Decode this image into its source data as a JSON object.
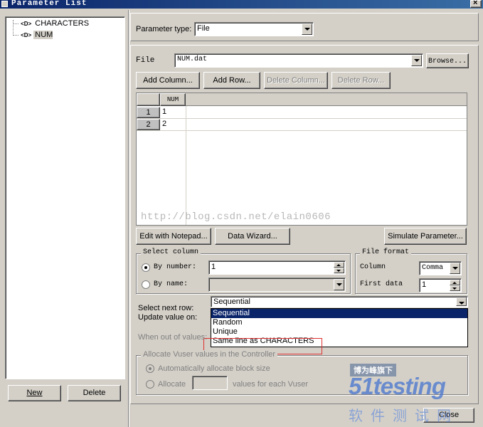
{
  "window": {
    "title": "Parameter List"
  },
  "tree": {
    "items": [
      {
        "tag": "<D>",
        "label": "CHARACTERS"
      },
      {
        "tag": "<D>",
        "label": "NUM"
      }
    ]
  },
  "bottom_buttons": {
    "new": "New",
    "delete": "Delete",
    "close": "Close"
  },
  "param_type": {
    "label": "Parameter type:",
    "value": "File"
  },
  "file": {
    "label": "File",
    "value": "NUM.dat",
    "browse": "Browse..."
  },
  "grid_buttons": {
    "add_column": "Add Column...",
    "add_row": "Add Row...",
    "delete_column": "Delete Column...",
    "delete_row": "Delete Row..."
  },
  "grid": {
    "header": "NUM",
    "rows": [
      {
        "num": "1",
        "value": "1"
      },
      {
        "num": "2",
        "value": "2"
      }
    ]
  },
  "watermark_text": "http://blog.csdn.net/elain0606",
  "tool_buttons": {
    "edit_notepad": "Edit with Notepad...",
    "data_wizard": "Data Wizard...",
    "simulate": "Simulate Parameter..."
  },
  "select_column": {
    "title": "Select column",
    "by_number": "By number:",
    "by_number_value": "1",
    "by_name": "By name:"
  },
  "file_format": {
    "title": "File format",
    "column_label": "Column",
    "column_value": "Comma",
    "first_data_label": "First data",
    "first_data_value": "1"
  },
  "select_next_row": {
    "label": "Select next row:",
    "value": "Sequential",
    "options": [
      "Sequential",
      "Random",
      "Unique",
      "Same line as CHARACTERS"
    ]
  },
  "update_value": {
    "label": "Update value on:"
  },
  "out_of_values": {
    "label": "When out of values:"
  },
  "allocate": {
    "title": "Allocate Vuser values in the Controller",
    "auto": "Automatically allocate block size",
    "manual": "Allocate",
    "suffix": "values for each Vuser"
  },
  "logo": {
    "badge": "博为峰旗下",
    "brand": "51testing",
    "cn": "软件测试网"
  },
  "colors": {
    "titlebar": "#0a246a",
    "selection": "#0a246a",
    "highlight_box": "#e03030"
  }
}
